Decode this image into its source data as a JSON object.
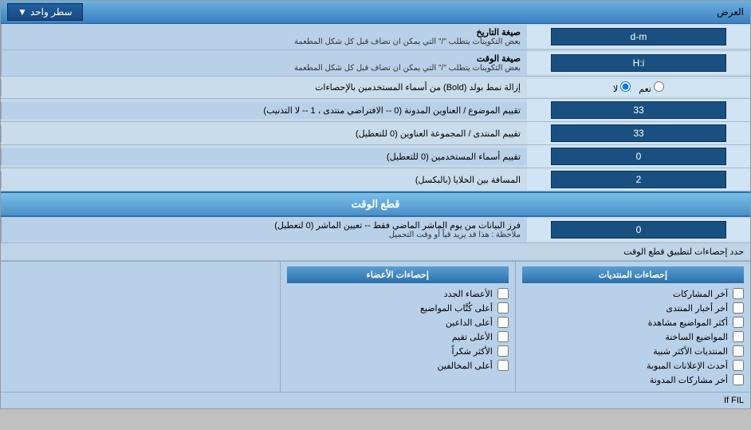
{
  "header": {
    "title": "العرض",
    "dropdown_label": "سطر واحد",
    "dropdown_icon": "▼"
  },
  "rows": [
    {
      "id": "date-format",
      "label": "صيغة التاريخ",
      "sublabel": "بعض التكوينات يتطلب \"/\" التي يمكن ان تضاف قبل كل شكل المطعمة",
      "value": "d-m",
      "type": "input"
    },
    {
      "id": "time-format",
      "label": "صيغة الوقت",
      "sublabel": "بعض التكوينات يتطلب \"/\" التي يمكن ان تضاف قبل كل شكل المطعمة",
      "value": "H:i",
      "type": "input"
    },
    {
      "id": "bold-remove",
      "label": "إزالة نمط بولد (Bold) من أسماء المستخدمين بالإحصاءات",
      "value_yes": "نعم",
      "value_no": "لا",
      "selected": "no",
      "type": "radio"
    },
    {
      "id": "topic-order",
      "label": "تقييم الموضوع / العناوين المدونة (0 -- الافتراضي منتدى ، 1 -- لا التذنيب)",
      "value": "33",
      "type": "input"
    },
    {
      "id": "forum-order",
      "label": "تقييم المنتدى / المجموعة العناوين (0 للتعطيل)",
      "value": "33",
      "type": "input"
    },
    {
      "id": "user-names",
      "label": "تقييم أسماء المستخدمين (0 للتعطيل)",
      "value": "0",
      "type": "input"
    },
    {
      "id": "cell-spacing",
      "label": "المسافة بين الخلايا (بالبكسل)",
      "value": "2",
      "type": "input"
    }
  ],
  "cutoff_section": {
    "title": "قطع الوقت",
    "row": {
      "label": "فرز البيانات من يوم الماشر الماضي فقط -- تعيين الماشر (0 لتعطيل)",
      "note": "ملاحظة : هذا قد يزيد قياً أو وقت التحميل",
      "value": "0"
    },
    "limit_label": "حدد إحصاءات لتطبيق قطع الوقت"
  },
  "stats_cols": [
    {
      "title": "إحصاءات المنتديات",
      "items": [
        {
          "label": "آخر المشاركات",
          "checked": false
        },
        {
          "label": "أخر أخبار المنتدى",
          "checked": false
        },
        {
          "label": "أكثر المواضيع مشاهدة",
          "checked": false
        },
        {
          "label": "المواضيع الساخنة",
          "checked": false
        },
        {
          "label": "المنتديات الأكثر شبية",
          "checked": false
        },
        {
          "label": "أحدث الإعلانات المبوبة",
          "checked": false
        },
        {
          "label": "أخر مشاركات المدونة",
          "checked": false
        }
      ]
    },
    {
      "title": "إحصاءات الأعضاء",
      "items": [
        {
          "label": "الأعضاء الجدد",
          "checked": false
        },
        {
          "label": "أعلى كُتَّاب المواضيع",
          "checked": false
        },
        {
          "label": "أعلى الداعين",
          "checked": false
        },
        {
          "label": "الأعلى تقيم",
          "checked": false
        },
        {
          "label": "الأكثر شكراً",
          "checked": false
        },
        {
          "label": "أعلى المخالفين",
          "checked": false
        }
      ]
    }
  ],
  "footer_note": "If FIL"
}
